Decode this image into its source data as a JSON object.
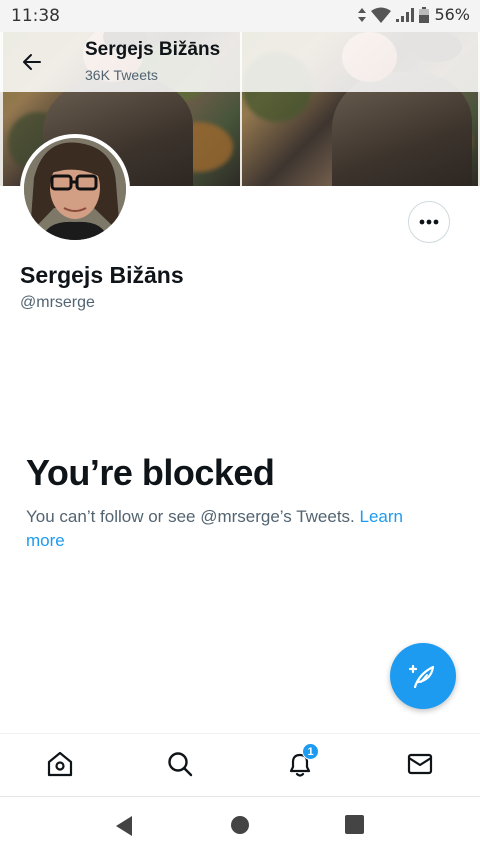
{
  "status_bar": {
    "time": "11:38",
    "battery_percent": "56%",
    "icons": [
      "data-arrows-icon",
      "wifi-icon",
      "signal-icon",
      "battery-icon"
    ]
  },
  "header": {
    "title": "Sergejs Bižāns",
    "tweet_count": "36K Tweets",
    "back_icon": "arrow-left-icon"
  },
  "profile": {
    "name": "Sergejs Bižāns",
    "handle": "@mrserge",
    "more_icon": "more-dots-icon"
  },
  "blocked": {
    "title": "You’re blocked",
    "message": "You can’t follow or see @mrserge’s Tweets.",
    "link_text": "Learn more"
  },
  "fab": {
    "icon": "compose-tweet-icon"
  },
  "bottom_nav": {
    "items": [
      {
        "name": "home",
        "icon": "home-icon"
      },
      {
        "name": "search",
        "icon": "search-icon"
      },
      {
        "name": "notifications",
        "icon": "bell-icon",
        "badge": "1"
      },
      {
        "name": "messages",
        "icon": "mail-icon"
      }
    ]
  },
  "system_nav": [
    "back-triangle-icon",
    "home-circle-icon",
    "recents-square-icon"
  ],
  "colors": {
    "accent": "#1d9bf0",
    "text_primary": "#0f1419",
    "text_secondary": "#536471"
  }
}
